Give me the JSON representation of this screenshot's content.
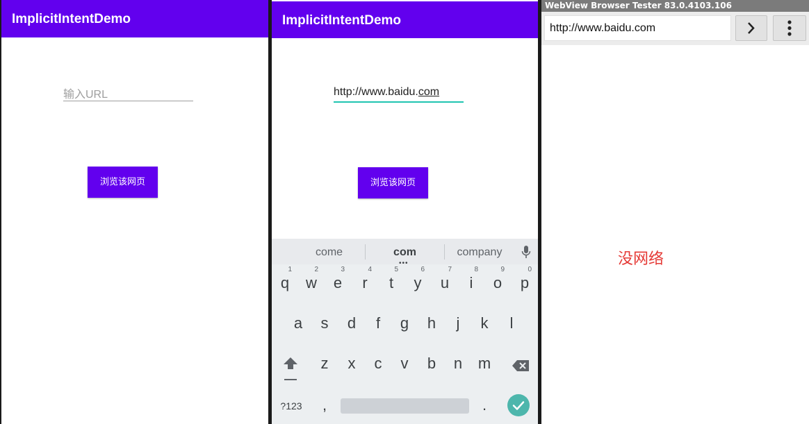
{
  "screen1": {
    "app_title": "ImplicitIntentDemo",
    "url_input": {
      "placeholder": "输入URL"
    },
    "browse_button": "浏览该网页"
  },
  "screen2": {
    "app_title": "ImplicitIntentDemo",
    "url_input": {
      "value_prefix": "http://www.baidu.",
      "value_underlined": "com"
    },
    "browse_button": "浏览该网页",
    "keyboard": {
      "suggestions": [
        "come",
        "com",
        "company"
      ],
      "row1": [
        {
          "key": "q",
          "hint": "1"
        },
        {
          "key": "w",
          "hint": "2"
        },
        {
          "key": "e",
          "hint": "3"
        },
        {
          "key": "r",
          "hint": "4"
        },
        {
          "key": "t",
          "hint": "5"
        },
        {
          "key": "y",
          "hint": "6"
        },
        {
          "key": "u",
          "hint": "7"
        },
        {
          "key": "i",
          "hint": "8"
        },
        {
          "key": "o",
          "hint": "9"
        },
        {
          "key": "p",
          "hint": "0"
        }
      ],
      "row2": [
        "a",
        "s",
        "d",
        "f",
        "g",
        "h",
        "j",
        "k",
        "l"
      ],
      "row3": [
        "z",
        "x",
        "c",
        "v",
        "b",
        "n",
        "m"
      ],
      "symbols_key": "?123",
      "comma_key": ",",
      "period_key": "."
    }
  },
  "screen3": {
    "window_title": "WebView Browser Tester 83.0.4103.106",
    "url": "http://www.baidu.com",
    "message": "没网络"
  },
  "icons": {
    "mic": "mic-icon",
    "shift": "shift-icon",
    "backspace": "backspace-icon",
    "enter": "check-icon",
    "go": "chevron-right-icon",
    "menu": "more-vert-icon"
  },
  "colors": {
    "primary": "#6200ee",
    "accent_underline": "#1fc4b0",
    "enter_key": "#4db6ac",
    "error_text": "#e53935"
  }
}
